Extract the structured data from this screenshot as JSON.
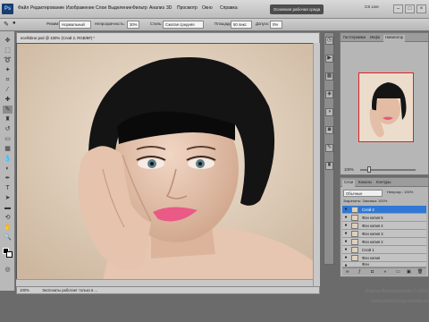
{
  "app": {
    "logo": "Ps"
  },
  "menu": [
    "Файл",
    "Редактирование",
    "Изображение",
    "Слои",
    "Выделение",
    "Фильтр",
    "Анализ",
    "3D",
    "Просмотр",
    "Окно",
    "Справка"
  ],
  "menu_extra": {
    "workspace": "Основная рабочая среда",
    "cslive": "CS Live"
  },
  "window_buttons": [
    "–",
    "□",
    "×"
  ],
  "options": {
    "mode_label": "Режим:",
    "mode_value": "Нормальный",
    "opacity_label": "Непрозрачность:",
    "opacity_value": "30%",
    "style_label": "Стиль:",
    "style_value": "Сжатая средняя",
    "area_label": "Площадь:",
    "area_value": "50 пикс",
    "tolerance_label": "Допуск:",
    "tolerance_value": "0%"
  },
  "document": {
    "tab": "ecellsbrur.psd @ 100% (Слой 2, RGB/8#) *",
    "zoom": "100%",
    "status": "Экспонаты работает только в ..."
  },
  "navigator": {
    "tabs": [
      "Гистограмма",
      "Инфо",
      "Навигатор"
    ],
    "zoom": "100%"
  },
  "layers": {
    "tabs": [
      "Слои",
      "Каналы",
      "Контуры"
    ],
    "blend_mode": "Обычные",
    "opacity_label": "Непрозр.:",
    "opacity_value": "100%",
    "lock_label": "Закрепить:",
    "fill_label": "Заливка:",
    "fill_value": "100%",
    "items": [
      {
        "name": "Слой 2",
        "selected": true
      },
      {
        "name": "Фон копия 5",
        "selected": false
      },
      {
        "name": "Фон копия 4",
        "selected": false
      },
      {
        "name": "Фон копия 3",
        "selected": false
      },
      {
        "name": "Фон копия 2",
        "selected": false
      },
      {
        "name": "Слой 1",
        "selected": false
      },
      {
        "name": "Фон копия",
        "selected": false
      },
      {
        "name": "Фон",
        "selected": false
      }
    ]
  },
  "watermark": {
    "line1": "Елена Виноградова © 2011",
    "line2": "www.photoshop-master.ru"
  },
  "colors": {
    "accent": "#2f78d6",
    "nav_frame": "#dd2222"
  }
}
